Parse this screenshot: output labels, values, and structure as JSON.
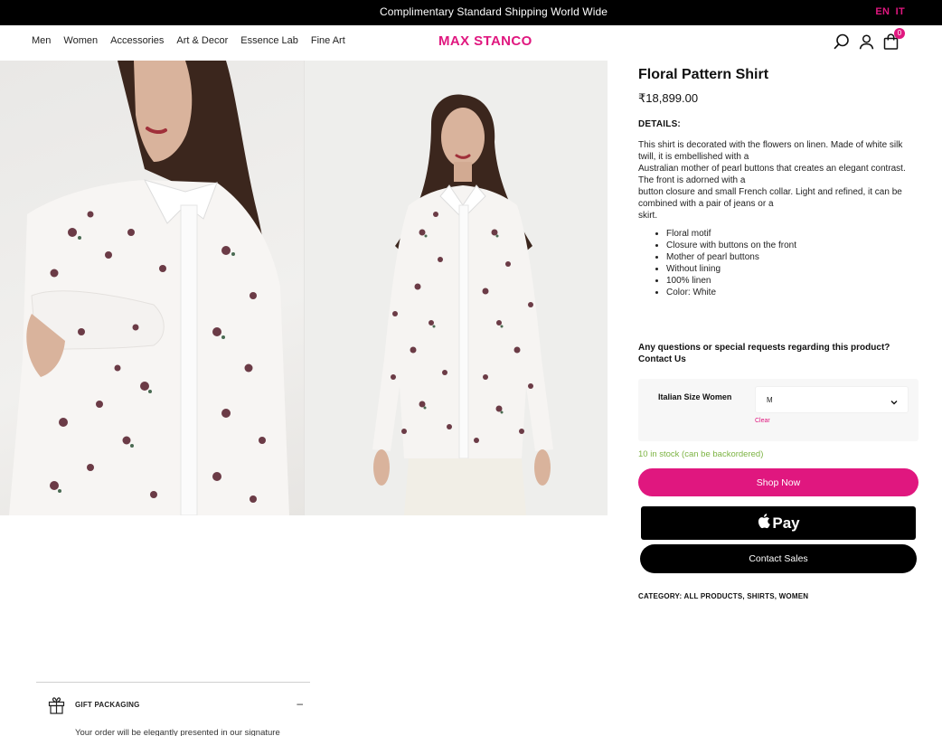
{
  "topbar": {
    "message": "Complimentary Standard Shipping World Wide",
    "lang_en": "EN",
    "lang_it": "IT"
  },
  "header": {
    "nav": [
      "Men",
      "Women",
      "Accessories",
      "Art & Decor",
      "Essence Lab",
      "Fine Art"
    ],
    "logo": "MAX STANCO",
    "cart_count": "0",
    "icons": [
      "search-icon",
      "user-icon",
      "cart-icon"
    ]
  },
  "product": {
    "title": "Floral Pattern Shirt",
    "price": "₹18,899.00",
    "details_heading": "DETAILS:",
    "description_lines": [
      "This shirt is decorated with the flowers on linen. Made of white silk twill, it is embellished with a",
      "Australian mother of pearl buttons that creates an elegant contrast. The front is adorned with a",
      "button closure and small French collar. Light and refined, it can be combined with a pair of jeans or a",
      "skirt."
    ],
    "features": [
      "Floral motif",
      "Closure with buttons on the front",
      "Mother of pearl buttons",
      "Without lining",
      "100% linen",
      "Color: White"
    ],
    "question": "Any questions or special requests regarding this product?",
    "contact_link": "Contact Us",
    "size_label": "Italian Size Women",
    "size_value": "M",
    "clear_label": "Clear",
    "stock": "10 in stock (can be backordered)",
    "shop_now": "Shop Now",
    "apple_pay": "Pay",
    "contact_sales": "Contact Sales",
    "category_label": "CATEGORY:",
    "categories": [
      "ALL PRODUCTS",
      "SHIRTS",
      "WOMEN"
    ]
  },
  "gift": {
    "title": "GIFT PACKAGING",
    "toggle": "–",
    "text": "Your order will be elegantly presented in our signature"
  },
  "colors": {
    "accent": "#e0177f",
    "topbar_bg": "#000000",
    "stock_green": "#7cb342"
  }
}
